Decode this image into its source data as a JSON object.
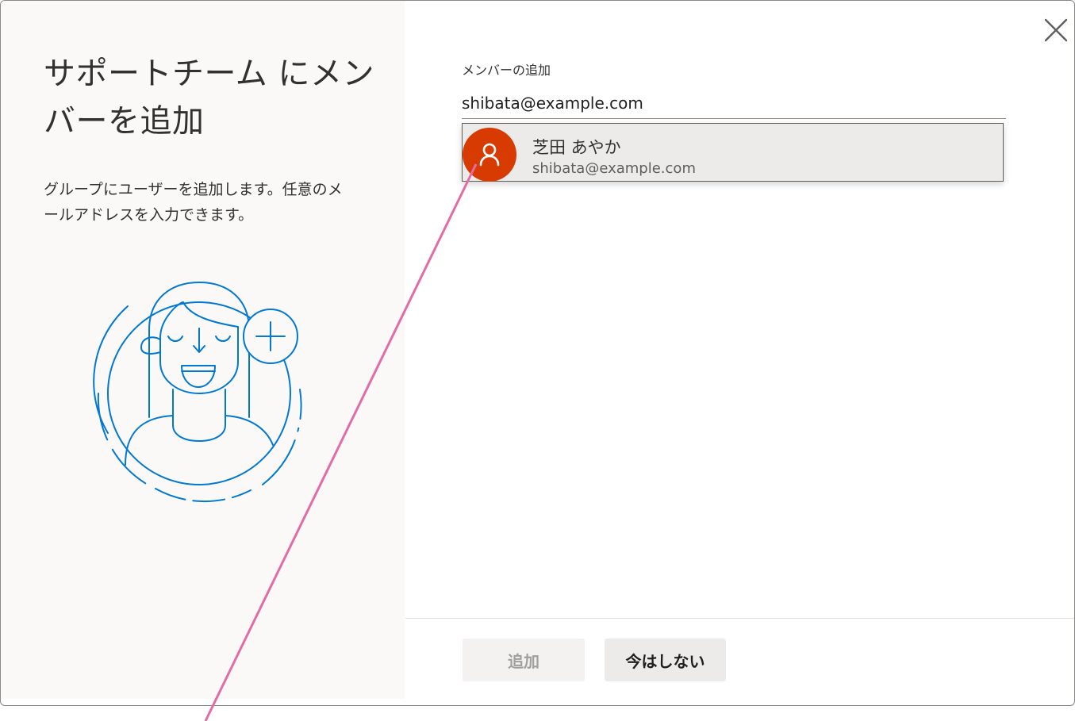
{
  "dialog": {
    "title": "サポートチーム にメンバーを追加",
    "description": "グループにユーザーを追加します。任意のメールアドレスを入力できます。"
  },
  "add_member": {
    "label": "メンバーの追加",
    "input_value": "shibata@example.com"
  },
  "suggestion": {
    "name": "芝田 あやか",
    "email": "shibata@example.com",
    "avatar_icon": "person-icon",
    "avatar_color": "#d83b01"
  },
  "buttons": {
    "add": "追加",
    "not_now": "今はしない"
  },
  "icons": {
    "close": "close-icon",
    "illustration": "add-person-illustration"
  },
  "colors": {
    "accent": "#0078d4",
    "annotation_line": "#e36ba6"
  }
}
